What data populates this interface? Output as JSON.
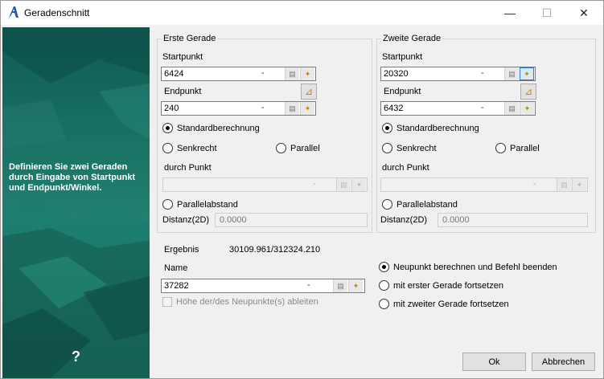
{
  "window": {
    "title": "Geradenschnitt",
    "minimize": "—",
    "maximize": "☐",
    "close": "✕"
  },
  "left_panel": {
    "description": "Definieren Sie zwei Geraden durch Eingabe von Startpunkt und Endpunkt/Winkel.",
    "help": "?"
  },
  "first_line": {
    "legend": "Erste Gerade",
    "start_label": "Startpunkt",
    "start_value": "6424",
    "end_label": "Endpunkt",
    "end_value": "240",
    "radio_standard": "Standardberechnung",
    "radio_perpendicular": "Senkrecht",
    "radio_parallel": "Parallel",
    "through_point_label": "durch Punkt",
    "through_point_value": "",
    "radio_parallel_distance": "Parallelabstand",
    "distance_label": "Distanz(2D)",
    "distance_value": "0.0000"
  },
  "second_line": {
    "legend": "Zweite Gerade",
    "start_label": "Startpunkt",
    "start_value": "20320",
    "end_label": "Endpunkt",
    "end_value": "6432",
    "radio_standard": "Standardberechnung",
    "radio_perpendicular": "Senkrecht",
    "radio_parallel": "Parallel",
    "through_point_label": "durch Punkt",
    "through_point_value": "",
    "radio_parallel_distance": "Parallelabstand",
    "distance_label": "Distanz(2D)",
    "distance_value": "0.0000"
  },
  "result": {
    "label": "Ergebnis",
    "value": "30109.961/312324.210",
    "name_label": "Name",
    "name_value": "37282",
    "derive_height": "Höhe der/des Neupunkte(s) ableiten"
  },
  "actions": {
    "option_new_point_end": "Neupunkt berechnen und Befehl beenden",
    "option_continue_first": "mit erster Gerade fortsetzen",
    "option_continue_second": "mit zweiter Gerade fortsetzen"
  },
  "buttons": {
    "ok": "Ok",
    "cancel": "Abbrechen"
  },
  "icons": {
    "field_dash": "-",
    "list": "▤",
    "pick": "✦",
    "pick_angle": "⊿"
  }
}
